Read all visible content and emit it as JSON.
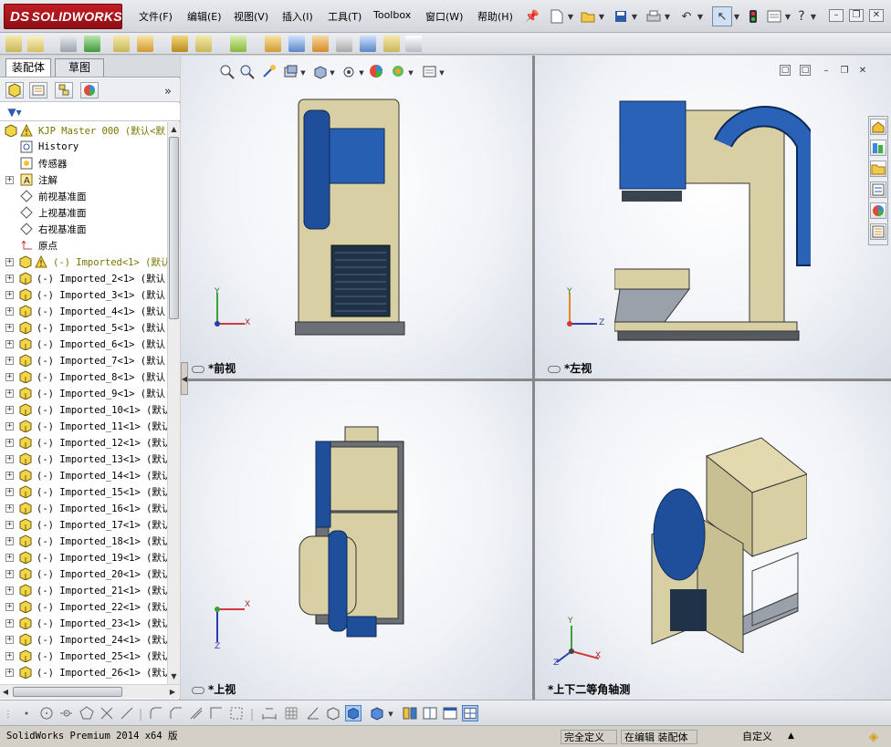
{
  "app": {
    "logo_prefix": "DS",
    "logo_text": "SOLIDWORKS"
  },
  "menu": [
    "文件(F)",
    "编辑(E)",
    "视图(V)",
    "插入(I)",
    "工具(T)",
    "Toolbox",
    "窗口(W)",
    "帮助(H)"
  ],
  "feature_manager": {
    "tabs": [
      "装配体",
      "草图"
    ],
    "tree": [
      {
        "label": "KJP Master 000 (默认<默",
        "style": "olive",
        "type": "root"
      },
      {
        "label": "History",
        "type": "history"
      },
      {
        "label": "传感器",
        "type": "sensor"
      },
      {
        "label": "注解",
        "type": "annotation",
        "expandable": true
      },
      {
        "label": "前视基准面",
        "type": "plane"
      },
      {
        "label": "上视基准面",
        "type": "plane"
      },
      {
        "label": "右视基准面",
        "type": "plane"
      },
      {
        "label": "原点",
        "type": "origin"
      },
      {
        "label": "(-) Imported<1> (默认<",
        "style": "olive",
        "type": "part-warn",
        "expandable": true
      },
      {
        "label": "(-) Imported_2<1> (默认",
        "type": "part",
        "expandable": true
      },
      {
        "label": "(-) Imported_3<1> (默认",
        "type": "part",
        "expandable": true
      },
      {
        "label": "(-) Imported_4<1> (默认",
        "type": "part",
        "expandable": true
      },
      {
        "label": "(-) Imported_5<1> (默认",
        "type": "part",
        "expandable": true
      },
      {
        "label": "(-) Imported_6<1> (默认",
        "type": "part",
        "expandable": true
      },
      {
        "label": "(-) Imported_7<1> (默认",
        "type": "part",
        "expandable": true
      },
      {
        "label": "(-) Imported_8<1> (默认",
        "type": "part",
        "expandable": true
      },
      {
        "label": "(-) Imported_9<1> (默认",
        "type": "part",
        "expandable": true
      },
      {
        "label": "(-) Imported_10<1> (默认",
        "type": "part",
        "expandable": true
      },
      {
        "label": "(-) Imported_11<1> (默认",
        "type": "part",
        "expandable": true
      },
      {
        "label": "(-) Imported_12<1> (默认",
        "type": "part",
        "expandable": true
      },
      {
        "label": "(-) Imported_13<1> (默认",
        "type": "part",
        "expandable": true
      },
      {
        "label": "(-) Imported_14<1> (默认",
        "type": "part",
        "expandable": true
      },
      {
        "label": "(-) Imported_15<1> (默认",
        "type": "part",
        "expandable": true
      },
      {
        "label": "(-) Imported_16<1> (默认",
        "type": "part",
        "expandable": true
      },
      {
        "label": "(-) Imported_17<1> (默认",
        "type": "part",
        "expandable": true
      },
      {
        "label": "(-) Imported_18<1> (默认",
        "type": "part",
        "expandable": true
      },
      {
        "label": "(-) Imported_19<1> (默认",
        "type": "part",
        "expandable": true
      },
      {
        "label": "(-) Imported_20<1> (默认",
        "type": "part",
        "expandable": true
      },
      {
        "label": "(-) Imported_21<1> (默认",
        "type": "part",
        "expandable": true
      },
      {
        "label": "(-) Imported_22<1> (默认",
        "type": "part",
        "expandable": true
      },
      {
        "label": "(-) Imported_23<1> (默认",
        "type": "part",
        "expandable": true
      },
      {
        "label": "(-) Imported_24<1> (默认",
        "type": "part",
        "expandable": true
      },
      {
        "label": "(-) Imported_25<1> (默认",
        "type": "part",
        "expandable": true
      },
      {
        "label": "(-) Imported_26<1> (默认",
        "type": "part",
        "expandable": true
      }
    ]
  },
  "viewports": [
    {
      "label": "*前视"
    },
    {
      "label": "*左视"
    },
    {
      "label": "*上视"
    },
    {
      "label": "*上下二等角轴测"
    }
  ],
  "axes": {
    "x": "X",
    "y": "Y",
    "z": "Z"
  },
  "status": {
    "product": "SolidWorks Premium 2014 x64 版",
    "definition": "完全定义",
    "mode": "在编辑 装配体",
    "units": "自定义",
    "units_caret": "▲"
  },
  "colors": {
    "body_beige": "#d8cfa4",
    "accent_blue": "#1f4f9a",
    "brand_red": "#b2151c"
  }
}
